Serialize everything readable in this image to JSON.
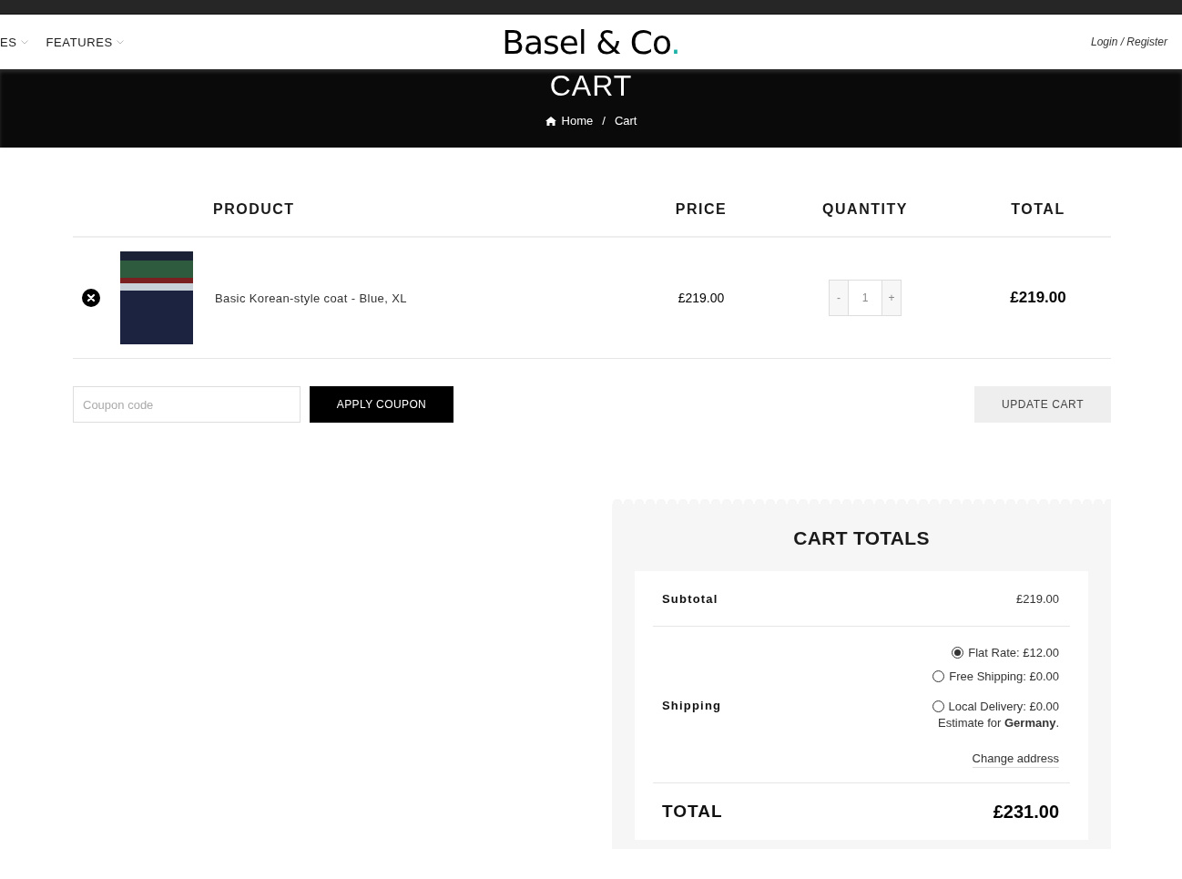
{
  "header": {
    "nav": [
      {
        "label": "ES"
      },
      {
        "label": "FEATURES"
      }
    ],
    "logo": {
      "text": "Basel & Co",
      "dot": "."
    },
    "account_link": "Login / Register"
  },
  "hero": {
    "title": "CART",
    "breadcrumb": [
      "Home",
      "Cart"
    ],
    "breadcrumb_separator": "/"
  },
  "cart_table": {
    "columns": [
      "PRODUCT",
      "PRICE",
      "QUANTITY",
      "TOTAL"
    ],
    "rows": [
      {
        "name": "Basic Korean-style coat - Blue, XL",
        "price": "£219.00",
        "quantity": "1",
        "total": "£219.00"
      }
    ]
  },
  "quantity_buttons": {
    "minus": "-",
    "plus": "+"
  },
  "coupon": {
    "placeholder": "Coupon code",
    "apply_button": "APPLY COUPON"
  },
  "update_button": "UPDATE CART",
  "cart_totals": {
    "title": "CART TOTALS",
    "subtotal_label": "Subtotal",
    "subtotal": "£219.00",
    "shipping_label": "Shipping",
    "shipping_options": [
      {
        "label": "Flat Rate: £12.00",
        "selected": true
      },
      {
        "label": "Free Shipping: £0.00",
        "selected": false
      },
      {
        "label": "Local Delivery: £0.00",
        "selected": false
      }
    ],
    "estimate": "Estimate for **Germany**.",
    "change_address": "Change address",
    "total_label": "TOTAL",
    "total": "£231.00"
  }
}
